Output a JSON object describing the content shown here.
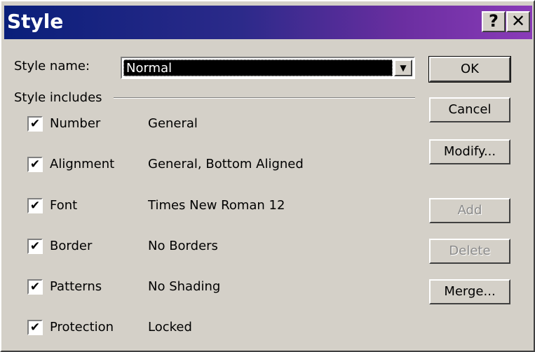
{
  "title": "Style",
  "title_buttons": {
    "help": "?",
    "close": "✕"
  },
  "style_name": {
    "label": "Style name:",
    "value": "Normal"
  },
  "style_includes_label": "Style includes",
  "includes": [
    {
      "label": "Number",
      "value": "General",
      "checked": true
    },
    {
      "label": "Alignment",
      "value": "General, Bottom Aligned",
      "checked": true
    },
    {
      "label": "Font",
      "value": "Times New Roman 12",
      "checked": true
    },
    {
      "label": "Border",
      "value": "No Borders",
      "checked": true
    },
    {
      "label": "Patterns",
      "value": "No Shading",
      "checked": true
    },
    {
      "label": "Protection",
      "value": "Locked",
      "checked": true
    }
  ],
  "buttons": {
    "ok": "OK",
    "cancel": "Cancel",
    "modify": "Modify...",
    "add": "Add",
    "delete": "Delete",
    "merge": "Merge..."
  },
  "checkmark": "✔",
  "colors": {
    "titlebar_start": "#0a1f7a",
    "titlebar_end": "#8a3bb8",
    "dialog_bg": "#d4d0c8"
  }
}
